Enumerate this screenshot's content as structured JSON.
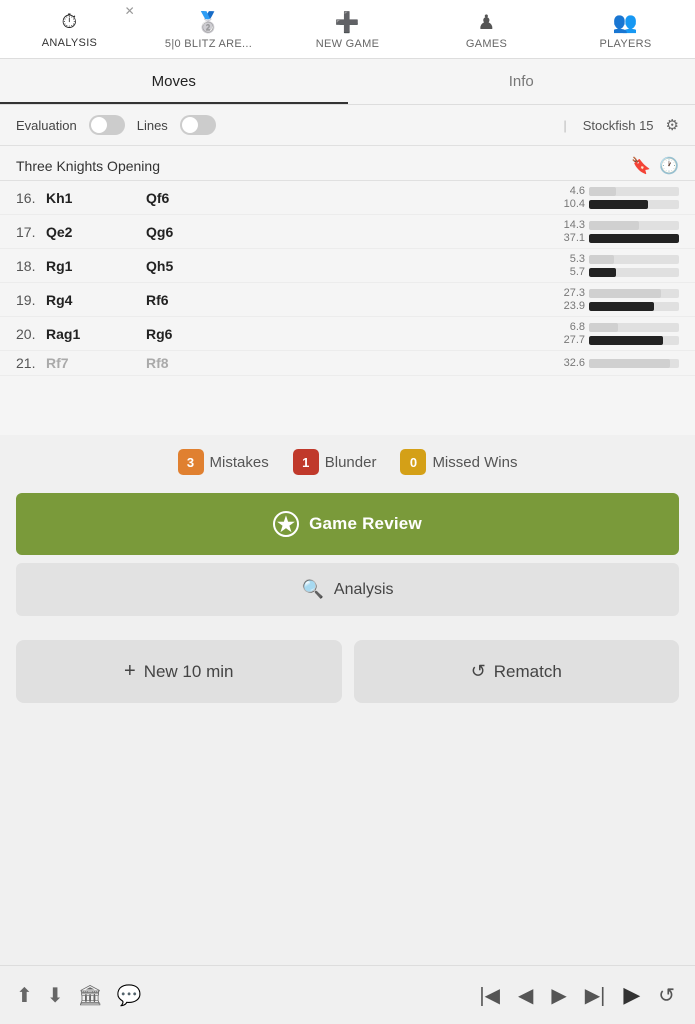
{
  "nav": {
    "items": [
      {
        "id": "analysis",
        "label": "ANALYSIS",
        "icon": "⏱",
        "active": true,
        "hasClose": true
      },
      {
        "id": "blitz",
        "label": "5|0 BLITZ ARE...",
        "icon": "🥈",
        "active": false,
        "hasClose": false
      },
      {
        "id": "new-game",
        "label": "NEW GAME",
        "icon": "➕",
        "active": false,
        "hasClose": false
      },
      {
        "id": "games",
        "label": "GAMES",
        "icon": "♟",
        "active": false,
        "hasClose": false
      },
      {
        "id": "players",
        "label": "PLAYERS",
        "icon": "👥",
        "active": false,
        "hasClose": false
      }
    ]
  },
  "tabs": {
    "moves_label": "Moves",
    "info_label": "Info"
  },
  "eval_section": {
    "evaluation_label": "Evaluation",
    "lines_label": "Lines",
    "stockfish_label": "Stockfish 15"
  },
  "opening": {
    "name": "Three Knights Opening"
  },
  "moves": [
    {
      "num": "16.",
      "white": "Kh1",
      "black": "Qf6",
      "w_val": "4.6",
      "b_val": "10.4",
      "w_pct": 30,
      "b_pct": 65
    },
    {
      "num": "17.",
      "white": "Qe2",
      "black": "Qg6",
      "w_val": "14.3",
      "b_val": "37.1",
      "w_pct": 55,
      "b_pct": 100
    },
    {
      "num": "18.",
      "white": "Rg1",
      "black": "Qh5",
      "w_val": "5.3",
      "b_val": "5.7",
      "w_pct": 28,
      "b_pct": 30
    },
    {
      "num": "19.",
      "white": "Rg4",
      "black": "Rf6",
      "w_val": "27.3",
      "b_val": "23.9",
      "w_pct": 80,
      "b_pct": 72
    },
    {
      "num": "20.",
      "white": "Rag1",
      "black": "Rg6",
      "w_val": "6.8",
      "b_val": "27.7",
      "w_pct": 32,
      "b_pct": 82
    },
    {
      "num": "21.",
      "white": "Rf7",
      "black": "Rf8",
      "w_val": "32.6",
      "b_val": "",
      "w_pct": 90,
      "b_pct": 0
    }
  ],
  "stats": {
    "mistakes": {
      "count": "3",
      "label": "Mistakes",
      "color": "orange"
    },
    "blunders": {
      "count": "1",
      "label": "Blunder",
      "color": "red"
    },
    "missed_wins": {
      "count": "0",
      "label": "Missed Wins",
      "color": "yellow"
    }
  },
  "buttons": {
    "game_review": "Game Review",
    "analysis": "Analysis",
    "new_game": "New 10 min",
    "rematch": "Rematch"
  },
  "bottom_toolbar": {
    "share_icon": "⬆",
    "download_icon": "⬇",
    "library_icon": "🏛",
    "chat_icon": "💬",
    "first_icon": "|◀",
    "prev_icon": "◀",
    "next_icon": "▶",
    "last_icon": "▶|",
    "play_icon": "▶",
    "refresh_icon": "↺"
  }
}
